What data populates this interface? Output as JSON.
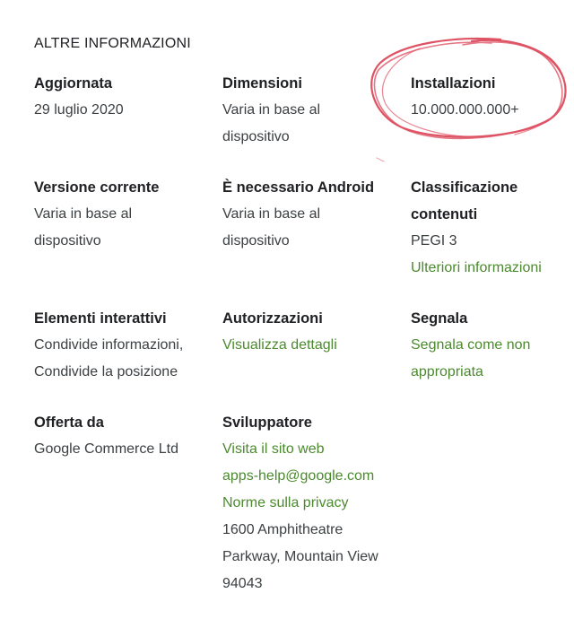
{
  "section": {
    "title": "ALTRE INFORMAZIONI"
  },
  "updated": {
    "label": "Aggiornata",
    "value": "29 luglio 2020"
  },
  "size": {
    "label": "Dimensioni",
    "value_line1": "Varia in base al",
    "value_line2": "dispositivo"
  },
  "installs": {
    "label": "Installazioni",
    "value": "10.000.000.000+"
  },
  "current_version": {
    "label": "Versione corrente",
    "value_line1": "Varia in base al",
    "value_line2": "dispositivo"
  },
  "requires_android": {
    "label": "È necessario Android",
    "value_line1": "Varia in base al",
    "value_line2": "dispositivo"
  },
  "content_rating": {
    "label_line1": "Classificazione",
    "label_line2": "contenuti",
    "value": "PEGI 3",
    "link": "Ulteriori informazioni"
  },
  "interactive_elements": {
    "label": "Elementi interattivi",
    "value_line1": "Condivide informazioni,",
    "value_line2": "Condivide la posizione"
  },
  "permissions": {
    "label": "Autorizzazioni",
    "link": "Visualizza dettagli"
  },
  "report": {
    "label": "Segnala",
    "link_line1": "Segnala come non",
    "link_line2": "appropriata"
  },
  "offered_by": {
    "label": "Offerta da",
    "value": "Google Commerce Ltd"
  },
  "developer": {
    "label": "Sviluppatore",
    "website_link": "Visita il sito web",
    "email_link": "apps-help@google.com",
    "privacy_link": "Norme sulla privacy",
    "address_line1": "1600 Amphitheatre",
    "address_line2": "Parkway, Mountain View",
    "address_line3": "94043"
  },
  "colors": {
    "text_primary": "#202124",
    "text_secondary": "#3c4043",
    "link_green": "#4b8a2e",
    "annotation_red": "#d9364a"
  }
}
